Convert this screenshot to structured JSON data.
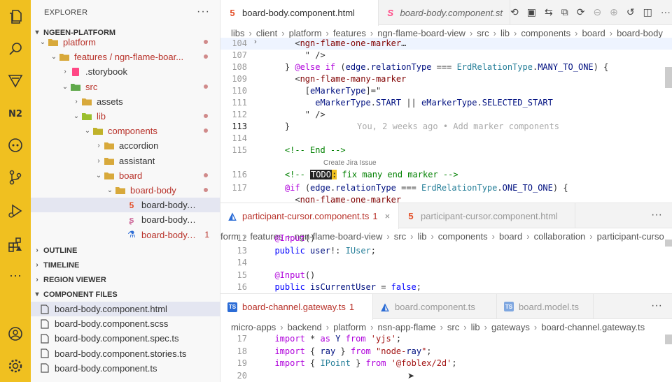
{
  "sidebar": {
    "title": "EXPLORER",
    "more": "···",
    "root": "NGEEN-PLATFORM",
    "tree": [
      {
        "label": "platform",
        "depth": 2,
        "kind": "folder",
        "mod": true,
        "dot": true
      },
      {
        "label": "features / ngn-flame-boar...",
        "depth": 3,
        "kind": "folder",
        "mod": true,
        "dot": true
      },
      {
        "label": ".storybook",
        "depth": 4,
        "kind": "storybook",
        "mod": false
      },
      {
        "label": "src",
        "depth": 4,
        "kind": "folder-src",
        "mod": true,
        "dot": true
      },
      {
        "label": "assets",
        "depth": 5,
        "kind": "folder",
        "mod": false
      },
      {
        "label": "lib",
        "depth": 5,
        "kind": "folder-lib",
        "mod": true,
        "dot": true
      },
      {
        "label": "components",
        "depth": 6,
        "kind": "folder-comp",
        "mod": true,
        "dot": true
      },
      {
        "label": "accordion",
        "depth": 7,
        "kind": "folder",
        "mod": false
      },
      {
        "label": "assistant",
        "depth": 7,
        "kind": "folder",
        "mod": false
      },
      {
        "label": "board",
        "depth": 7,
        "kind": "folder",
        "mod": true,
        "dot": true
      },
      {
        "label": "board-body",
        "depth": 8,
        "kind": "folder",
        "mod": true,
        "dot": true
      },
      {
        "label": "board-body.componen...",
        "depth": 9,
        "kind": "html",
        "mod": false
      },
      {
        "label": "board-body.componen...",
        "depth": 9,
        "kind": "scss",
        "mod": false
      },
      {
        "label": "board-body.comp...",
        "depth": 9,
        "kind": "spec",
        "mod": true,
        "count": "1"
      }
    ],
    "sections": [
      "OUTLINE",
      "TIMELINE",
      "REGION VIEWER",
      "COMPONENT FILES"
    ],
    "component_files": [
      "board-body.component.html",
      "board-body.component.scss",
      "board-body.component.spec.ts",
      "board-body.component.stories.ts",
      "board-body.component.ts"
    ]
  },
  "editor1": {
    "tabs": [
      {
        "label": "board-body.component.html",
        "icon": "html-icon"
      },
      {
        "label": "board-body.component.st",
        "icon": "storybook-icon"
      }
    ],
    "crumbs": [
      "libs",
      "client",
      "platform",
      "features",
      "ngn-flame-board-view",
      "src",
      "lib",
      "components",
      "board",
      "board-body"
    ],
    "lines": [
      {
        "n": "104",
        "t": "      <ngn-flame-one-marker…"
      },
      {
        "n": "107",
        "t": "        \" />"
      },
      {
        "n": "108",
        "t": "    } @else if (edge.relationType === ErdRelationType.MANY_TO_ONE) {"
      },
      {
        "n": "109",
        "t": "      <ngn-flame-many-marker"
      },
      {
        "n": "110",
        "t": "        [eMarkerType]=\""
      },
      {
        "n": "111",
        "t": "          eMarkerType.START || eMarkerType.SELECTED_START"
      },
      {
        "n": "112",
        "t": "        \" />"
      },
      {
        "n": "113",
        "t": "    }"
      },
      {
        "n": "114",
        "t": ""
      },
      {
        "n": "115",
        "t": "    <!-- End -->"
      },
      {
        "n": "116",
        "t": ""
      },
      {
        "n": "117",
        "t": "    @if (edge.relationType === ErdRelationType.ONE_TO_ONE) {"
      },
      {
        "n": "",
        "t": "      <ngn-flame-one-marker"
      }
    ],
    "blame": "You, 2 weeks ago • Add marker components",
    "codelens": "Create Jira Issue",
    "todo_line": {
      "pre": "    <!-- ",
      "todo": "TODO",
      "colon": ":",
      "post": " fix many end marker -->"
    }
  },
  "editor2": {
    "tabs": [
      {
        "label": "participant-cursor.component.ts",
        "count": "1",
        "close": "×"
      },
      {
        "label": "participant-cursor.component.html"
      }
    ],
    "crumbs": [
      "form",
      "features",
      "ngn-flame-board-view",
      "src",
      "lib",
      "components",
      "board",
      "collaboration",
      "participant-curso"
    ],
    "lines": [
      {
        "n": "12",
        "t": "  @Input()"
      },
      {
        "n": "13",
        "t": "  public user!: IUser;"
      },
      {
        "n": "14",
        "t": ""
      },
      {
        "n": "15",
        "t": "  @Input()"
      },
      {
        "n": "16",
        "t": "  public isCurrentUser = false;"
      }
    ]
  },
  "editor3": {
    "tabs": [
      {
        "label": "board-channel.gateway.ts",
        "count": "1"
      },
      {
        "label": "board.component.ts"
      },
      {
        "label": "board.model.ts"
      }
    ],
    "crumbs": [
      "micro-apps",
      "backend",
      "platform",
      "nsn-app-flame",
      "src",
      "lib",
      "gateways",
      "board-channel.gateway.ts"
    ],
    "lines": [
      {
        "n": "17",
        "t": "  import * as Y from 'yjs';"
      },
      {
        "n": "18",
        "t": "  import { ray } from \"node-ray\";"
      },
      {
        "n": "19",
        "t": "  import { IPoint } from '@foblex/2d';"
      },
      {
        "n": "20",
        "t": ""
      }
    ]
  },
  "colors": {
    "activity": "#f0c020",
    "modified": "#b8322a"
  }
}
